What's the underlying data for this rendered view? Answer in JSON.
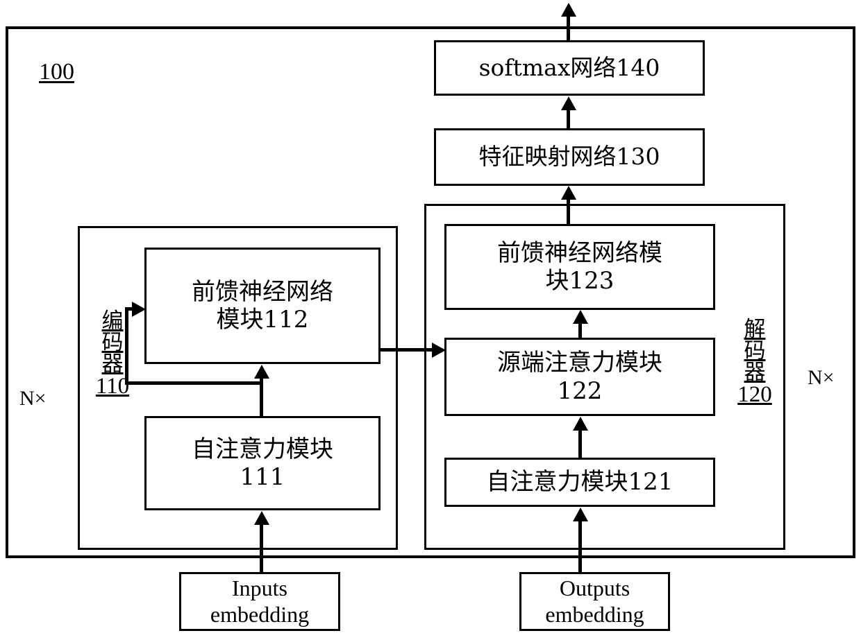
{
  "diagram": {
    "figure_number": "100",
    "outer_frame_name": "system-100",
    "repeat_label_left": "N×",
    "repeat_label_right": "N×",
    "boxes": {
      "softmax": "softmax网络140",
      "feature_mapping": "特征映射网络130",
      "encoder_ffn": "前馈神经网络\n模块112",
      "encoder_self_attention": "自注意力模块\n111",
      "decoder_ffn": "前馈神经网络模\n块123",
      "decoder_source_attention": "源端注意力模块\n122",
      "decoder_self_attention": "自注意力模块121",
      "inputs_embedding": "Inputs\nembedding",
      "outputs_embedding": "Outputs\nembedding"
    },
    "encoder_label": {
      "chars": [
        "编",
        "码",
        "器"
      ],
      "number": "110"
    },
    "decoder_label": {
      "chars": [
        "解",
        "码",
        "器"
      ],
      "number": "120"
    },
    "colors": {
      "stroke": "#000000",
      "background": "#ffffff"
    }
  }
}
